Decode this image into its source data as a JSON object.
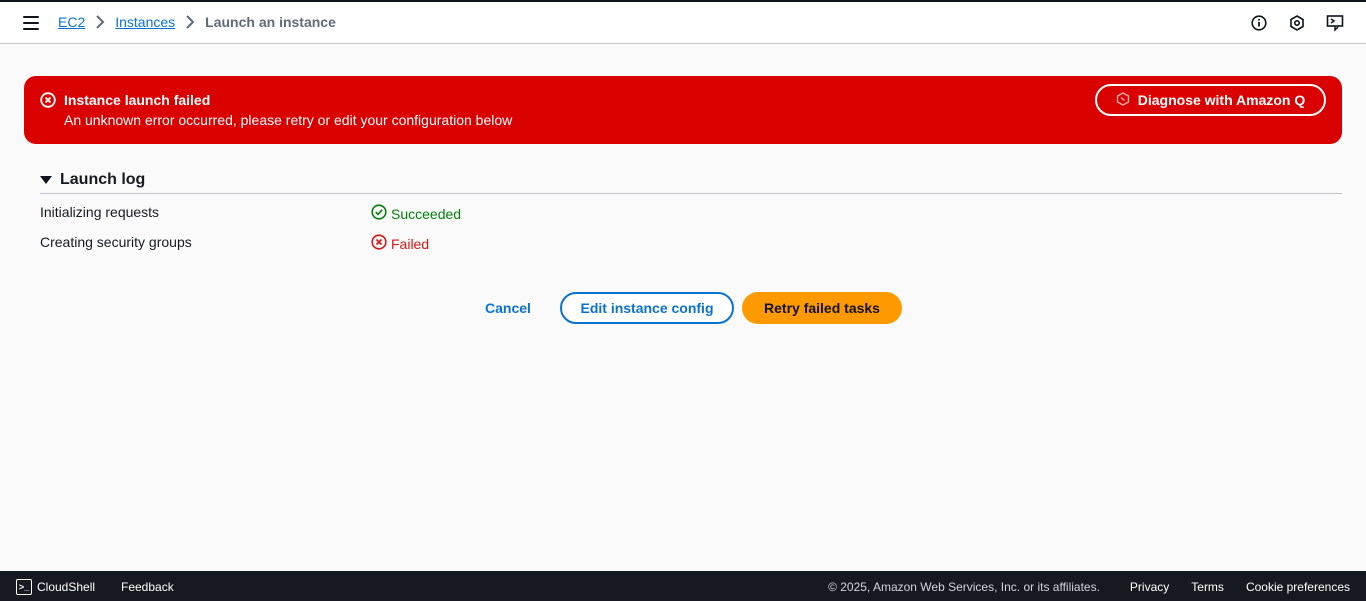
{
  "header": {
    "breadcrumbs": [
      "EC2",
      "Instances"
    ],
    "current_page": "Launch an instance"
  },
  "alert": {
    "title": "Instance launch failed",
    "message": "An unknown error occurred, please retry or edit your configuration below",
    "button_label": "Diagnose with Amazon Q",
    "color": "#db0000"
  },
  "launch_log": {
    "title": "Launch log",
    "rows": [
      {
        "label": "Initializing requests",
        "status": "Succeeded",
        "state": "success"
      },
      {
        "label": "Creating security groups",
        "status": "Failed",
        "state": "error"
      }
    ]
  },
  "actions": {
    "cancel": "Cancel",
    "edit": "Edit instance config",
    "retry": "Retry failed tasks"
  },
  "footer": {
    "cloudshell": "CloudShell",
    "feedback": "Feedback",
    "copyright": "© 2025, Amazon Web Services, Inc. or its affiliates.",
    "links": [
      "Privacy",
      "Terms",
      "Cookie preferences"
    ]
  },
  "colors": {
    "link": "#0972d3",
    "primary_button": "#ff9900",
    "success": "#037f0c",
    "error": "#d91515",
    "footer_bg": "#16191f"
  },
  "icons": {
    "menu": "hamburger-menu-icon",
    "info": "info-icon",
    "notifications": "hexagon-icon",
    "cloudshell": "terminal-icon",
    "error": "x-circle-icon",
    "success": "check-circle-icon"
  }
}
